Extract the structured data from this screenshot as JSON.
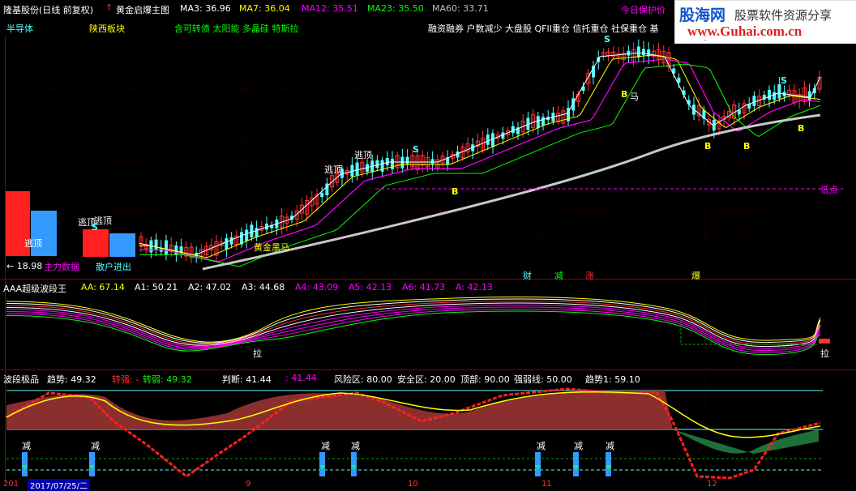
{
  "header": {
    "stock_name": "隆基股份(日线 前复权)",
    "indicator_name": "黄金启爆主图",
    "ma3": "MA3: 36.96",
    "ma7": "MA7: 36.04",
    "ma12": "MA12: 35.51",
    "ma23": "MA23: 35.50",
    "ma60": "MA60: 33.71",
    "right_label": "今日保护价"
  },
  "watermark": {
    "logo_text": "股海网",
    "slogan": "股票软件资源分享",
    "url": "www.Guhai.com.cn"
  },
  "tags": {
    "sector1": "半导体",
    "sector2": "陕西板块",
    "concepts": "含可转债 太阳能 多晶硅 特斯拉",
    "features": "融资融券 户数减少 大盘股 QFII重仓 信托重仓 社保重仓 基"
  },
  "main_chart": {
    "labels": {
      "escape1": "逃顶",
      "escape2": "逃顶",
      "escape3": "逃顶",
      "escape4": "逃顶",
      "low_point": "低点",
      "price_low": "← 18.98",
      "gold_horse": "黄金黑马",
      "main_data": "主力数据",
      "retail": "散户进出",
      "cai": "财",
      "jian": "减",
      "zhang": "涨",
      "bao": "爆",
      "ma_label": "马",
      "s": "S",
      "b": "B"
    }
  },
  "panel2": {
    "title": "AAA超级波段王",
    "aa": "AA: 67.14",
    "a1": "A1: 50.21",
    "a2": "A2: 47.02",
    "a3": "A3: 44.68",
    "a4": "A4: 43.09",
    "a5": "A5: 42.13",
    "a6": "A6: 41.73",
    "a": "A: 42.13",
    "la1": "拉",
    "la2": "拉"
  },
  "panel3": {
    "title": "波段极品",
    "trend": "趋势: 49.32",
    "strong": "转强: -",
    "weak": "转弱: 49.32",
    "judge": "判断: 41.44",
    "judge2": ": 41.44",
    "risk": "风险区: 80.00",
    "safe": "安全区: 20.00",
    "top": "顶部: 90.00",
    "strongline": "强弱线: 50.00",
    "trend1": "趋势1: 59.10",
    "jian": "减"
  },
  "axis": {
    "date": "2017/07/25/二",
    "year": "201",
    "m9": "9",
    "m10": "10",
    "m11": "11",
    "m12": "12"
  },
  "colors": {
    "up": "#ff3232",
    "down": "#54ffff",
    "ma3": "#ffffff",
    "ma7": "#ffff00",
    "ma12": "#ff00ff",
    "ma23": "#00ff00",
    "ma60": "#c0c0c0"
  }
}
